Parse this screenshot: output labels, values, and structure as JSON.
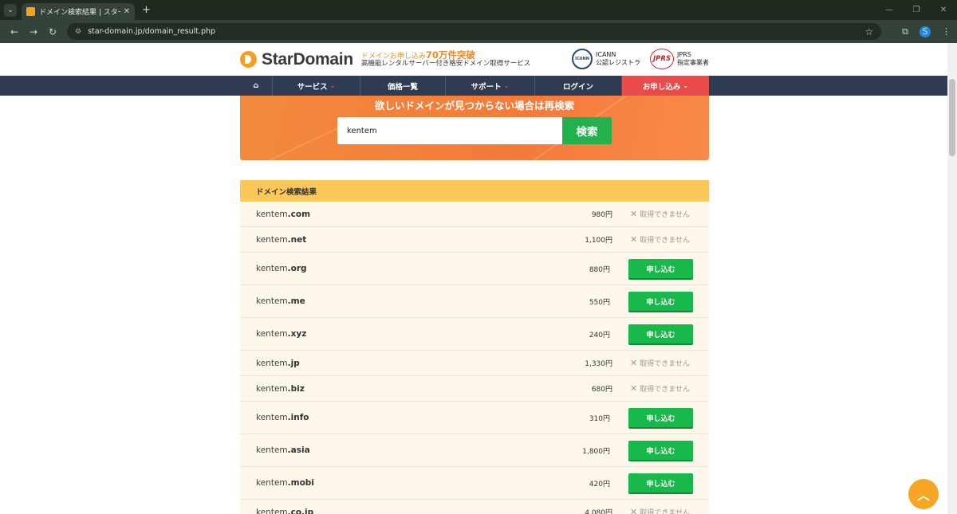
{
  "browser": {
    "tab_title": "ドメイン検索結果 | スタードメイン - 格",
    "url": "star-domain.jp/domain_result.php",
    "profile_initial": "S"
  },
  "header": {
    "logo_text": "StarDomain",
    "tagline_prefix": "ドメインお申し込み",
    "tagline_highlight": "70万件突破",
    "tagline_sub": "高機能レンタルサーバー付き格安ドメイン取得サービス",
    "icann_logo": "ICANN",
    "icann_line1": "ICANN",
    "icann_line2": "公認レジストラ",
    "jprs_logo": "JPRS",
    "jprs_line1": "JPRS",
    "jprs_line2": "指定事業者"
  },
  "nav": {
    "home_icon": "home-icon",
    "service": "サービス",
    "price_list": "価格一覧",
    "support": "サポート",
    "login": "ログイン",
    "apply": "お申し込み"
  },
  "search": {
    "title": "欲しいドメインが見つからない場合は再検索",
    "value": "kentem",
    "button": "検索"
  },
  "results": {
    "header": "ドメイン検索結果",
    "unavailable_label": "取得できません",
    "apply_label": "申し込む",
    "rows": [
      {
        "name": "kentem",
        "tld": ".com",
        "price": "980円",
        "available": false
      },
      {
        "name": "kentem",
        "tld": ".net",
        "price": "1,100円",
        "available": false
      },
      {
        "name": "kentem",
        "tld": ".org",
        "price": "880円",
        "available": true
      },
      {
        "name": "kentem",
        "tld": ".me",
        "price": "550円",
        "available": true
      },
      {
        "name": "kentem",
        "tld": ".xyz",
        "price": "240円",
        "available": true
      },
      {
        "name": "kentem",
        "tld": ".jp",
        "price": "1,330円",
        "available": false
      },
      {
        "name": "kentem",
        "tld": ".biz",
        "price": "680円",
        "available": false
      },
      {
        "name": "kentem",
        "tld": ".info",
        "price": "310円",
        "available": true
      },
      {
        "name": "kentem",
        "tld": ".asia",
        "price": "1,800円",
        "available": true
      },
      {
        "name": "kentem",
        "tld": ".mobi",
        "price": "420円",
        "available": true
      },
      {
        "name": "kentem",
        "tld": ".co.jp",
        "price": "4,080円",
        "available": false
      }
    ]
  },
  "colors": {
    "nav_bg": "#2e3b52",
    "apply_nav": "#e94a4a",
    "search_bg": "#f47a3a",
    "search_button": "#22b14c",
    "results_header": "#fcc85a",
    "apply_button": "#18b84b",
    "back_to_top": "#f6a623"
  }
}
